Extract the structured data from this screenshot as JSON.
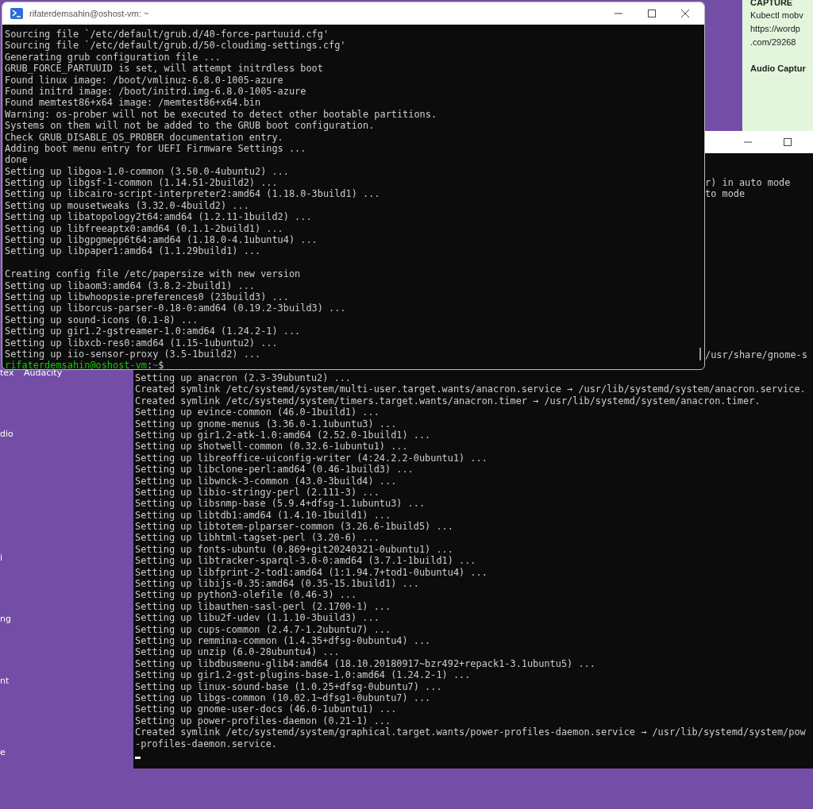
{
  "desktop": {
    "icon_labels": [
      "tex",
      "Audacity",
      "dio",
      "i",
      "ng",
      "nt",
      "e"
    ]
  },
  "note": {
    "heading": "CAPTURE",
    "lines": [
      "Kubectl mobv",
      "https://wordp",
      ".com/29268"
    ],
    "subheading": "Audio Captur"
  },
  "back_terminal": {
    "fragments": [
      "r) in auto mode",
      "to mode",
      "/usr/share/gnome-s"
    ],
    "lines": [
      "Setting up anacron (2.3-39ubuntu2) ...",
      "Created symlink /etc/systemd/system/multi-user.target.wants/anacron.service → /usr/lib/systemd/system/anacron.service.",
      "Created symlink /etc/systemd/system/timers.target.wants/anacron.timer → /usr/lib/systemd/system/anacron.timer.",
      "Setting up evince-common (46.0-1build1) ...",
      "Setting up gnome-menus (3.36.0-1.1ubuntu3) ...",
      "Setting up gir1.2-atk-1.0:amd64 (2.52.0-1build1) ...",
      "Setting up shotwell-common (0.32.6-1ubuntu1) ...",
      "Setting up libreoffice-uiconfig-writer (4:24.2.2-0ubuntu1) ...",
      "Setting up libclone-perl:amd64 (0.46-1build3) ...",
      "Setting up libwnck-3-common (43.0-3build4) ...",
      "Setting up libio-stringy-perl (2.111-3) ...",
      "Setting up libsnmp-base (5.9.4+dfsg-1.1ubuntu3) ...",
      "Setting up libtdb1:amd64 (1.4.10-1build1) ...",
      "Setting up libtotem-plparser-common (3.26.6-1build5) ...",
      "Setting up libhtml-tagset-perl (3.20-6) ...",
      "Setting up fonts-ubuntu (0.869+git20240321-0ubuntu1) ...",
      "Setting up libtracker-sparql-3.0-0:amd64 (3.7.1-1build1) ...",
      "Setting up libfprint-2-tod1:amd64 (1:1.94.7+tod1-0ubuntu4) ...",
      "Setting up libijs-0.35:amd64 (0.35-15.1build1) ...",
      "Setting up python3-olefile (0.46-3) ...",
      "Setting up libauthen-sasl-perl (2.1700-1) ...",
      "Setting up libu2f-udev (1.1.10-3build3) ...",
      "Setting up cups-common (2.4.7-1.2ubuntu7) ...",
      "Setting up remmina-common (1.4.35+dfsg-0ubuntu4) ...",
      "Setting up unzip (6.0-28ubuntu4) ...",
      "Setting up libdbusmenu-glib4:amd64 (18.10.20180917~bzr492+repack1-3.1ubuntu5) ...",
      "Setting up gir1.2-gst-plugins-base-1.0:amd64 (1.24.2-1) ...",
      "Setting up linux-sound-base (1.0.25+dfsg-0ubuntu7) ...",
      "Setting up libgs-common (10.02.1~dfsg1-0ubuntu7) ...",
      "Setting up gnome-user-docs (46.0-1ubuntu1) ...",
      "Setting up power-profiles-daemon (0.21-1) ...",
      "Created symlink /etc/systemd/system/graphical.target.wants/power-profiles-daemon.service → /usr/lib/systemd/system/pow",
      "-profiles-daemon.service."
    ]
  },
  "front_terminal": {
    "title": "rifaterdemsahin@oshost-vm: ~",
    "output_blocks": [
      [
        "Sourcing file `/etc/default/grub.d/40-force-partuuid.cfg'",
        "Sourcing file `/etc/default/grub.d/50-cloudimg-settings.cfg'",
        "Generating grub configuration file ...",
        "GRUB_FORCE_PARTUUID is set, will attempt initrdless boot",
        "Found linux image: /boot/vmlinuz-6.8.0-1005-azure",
        "Found initrd image: /boot/initrd.img-6.8.0-1005-azure",
        "Found memtest86+x64 image: /memtest86+x64.bin",
        "Warning: os-prober will not be executed to detect other bootable partitions.",
        "Systems on them will not be added to the GRUB boot configuration.",
        "Check GRUB_DISABLE_OS_PROBER documentation entry.",
        "Adding boot menu entry for UEFI Firmware Settings ...",
        "done",
        "Setting up libgoa-1.0-common (3.50.0-4ubuntu2) ...",
        "Setting up libgsf-1-common (1.14.51-2build2) ...",
        "Setting up libcairo-script-interpreter2:amd64 (1.18.0-3build1) ...",
        "Setting up mousetweaks (3.32.0-4build2) ...",
        "Setting up libatopology2t64:amd64 (1.2.11-1build2) ...",
        "Setting up libfreeaptx0:amd64 (0.1.1-2build1) ...",
        "Setting up libgpgmepp6t64:amd64 (1.18.0-4.1ubuntu4) ...",
        "Setting up libpaper1:amd64 (1.1.29build1) ..."
      ],
      [
        "Creating config file /etc/papersize with new version",
        "Setting up libaom3:amd64 (3.8.2-2build1) ...",
        "Setting up libwhoopsie-preferences0 (23build3) ...",
        "Setting up liborcus-parser-0.18-0:amd64 (0.19.2-3build3) ...",
        "Setting up sound-icons (0.1-8) ...",
        "Setting up gir1.2-gstreamer-1.0:amd64 (1.24.2-1) ...",
        "Setting up libxcb-res0:amd64 (1.15-1ubuntu2) ...",
        "Setting up iio-sensor-proxy (3.5-1build2) ..."
      ]
    ],
    "prompt": {
      "user_host": "rifaterdemsahin@oshost-vm",
      "separator": ":",
      "path": "~",
      "symbol": "$"
    }
  }
}
